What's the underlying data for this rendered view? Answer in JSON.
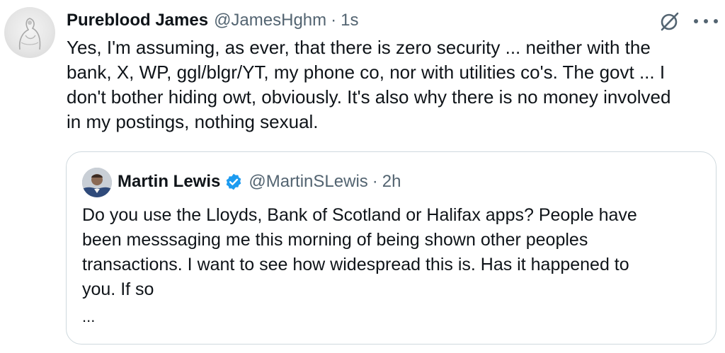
{
  "post": {
    "display_name": "Pureblood James",
    "handle": "@JamesHghm",
    "separator": "·",
    "time": "1s",
    "text": "Yes, I'm assuming, as ever, that there is zero security ... neither with the\nbank, X, WP, ggl/blgr/YT, my phone co, nor with utilities co's. The govt ... I\ndon't bother hiding owt, obviously. It's also why there is no money involved\nin my postings, nothing sexual.",
    "icons": {
      "avatar": "avatar-image",
      "grok": "grok-icon",
      "more": "more-icon"
    }
  },
  "quoted_post": {
    "display_name": "Martin Lewis",
    "handle": "@MartinSLewis",
    "separator": "·",
    "time": "2h",
    "text": "Do you use the Lloyds, Bank of Scotland or Halifax apps? People have\nbeen messsaging me this morning of being shown other peoples\ntransactions. I want to see how widespread this is. Has it happened to\nyou. If so",
    "truncation": "...",
    "icons": {
      "verified": "verified-badge-icon"
    }
  },
  "colors": {
    "text_primary": "#0f1419",
    "text_secondary": "#536471",
    "border": "#cfd9de",
    "verified_blue": "#1d9bf0"
  }
}
